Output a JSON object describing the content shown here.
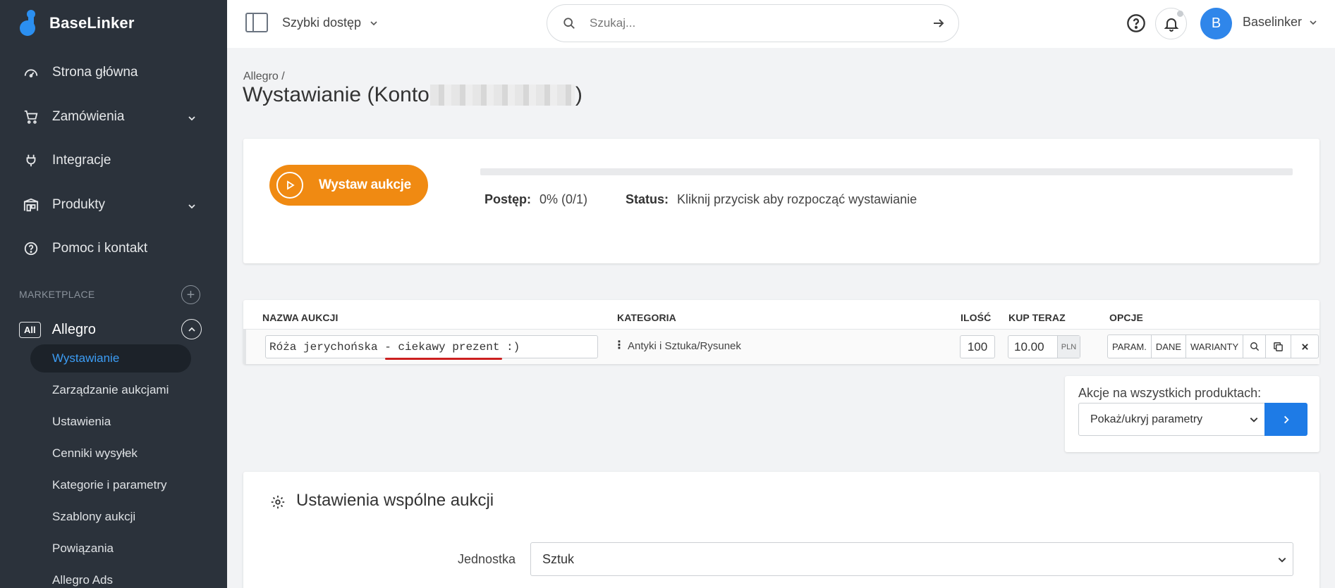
{
  "app": {
    "name": "BaseLinker"
  },
  "sidebar": {
    "nav": [
      {
        "label": "Strona główna",
        "icon": "dashboard-icon"
      },
      {
        "label": "Zamówienia",
        "icon": "cart-icon"
      },
      {
        "label": "Integracje",
        "icon": "plug-icon"
      },
      {
        "label": "Produkty",
        "icon": "warehouse-icon"
      },
      {
        "label": "Pomoc i kontakt",
        "icon": "help-icon"
      }
    ],
    "section_label": "MARKETPLACE",
    "all_badge": "All",
    "allegro_label": "Allegro",
    "sub_items": [
      {
        "label": "Wystawianie",
        "active": true
      },
      {
        "label": "Zarządzanie aukcjami"
      },
      {
        "label": "Ustawienia"
      },
      {
        "label": "Cenniki wysyłek"
      },
      {
        "label": "Kategorie i parametry"
      },
      {
        "label": "Szablony aukcji"
      },
      {
        "label": "Powiązania"
      },
      {
        "label": "Allegro Ads"
      }
    ]
  },
  "topbar": {
    "quick_access": "Szybki dostęp",
    "search_placeholder": "Szukaj...",
    "avatar_letter": "B",
    "user_name": "Baselinker"
  },
  "page": {
    "breadcrumb": "Allegro /",
    "title_prefix": "Wystawianie (Konto ",
    "title_suffix": ")"
  },
  "progress_card": {
    "button_label": "Wystaw aukcje",
    "progress_fraction": 0,
    "progress_label": "Postęp:",
    "progress_value": "0% (0/1)",
    "status_label": "Status:",
    "status_value": "Kliknij przycisk aby rozpocząć wystawianie"
  },
  "table": {
    "headers": {
      "name": "NAZWA AUKCJI",
      "category": "KATEGORIA",
      "qty": "ILOŚĆ",
      "buy_now": "KUP TERAZ",
      "options": "OPCJE"
    },
    "row": {
      "name": "Róża jerychońska - ciekawy prezent :)",
      "category": "Antyki i Sztuka/Rysunek",
      "qty": "100",
      "price": "10.00",
      "currency": "PLN",
      "btn_param": "PARAM.",
      "btn_dane": "DANE",
      "btn_warianty": "WARIANTY"
    }
  },
  "bulk_actions": {
    "label": "Akcje na wszystkich produktach:",
    "selected": "Pokaż/ukryj parametry"
  },
  "common_settings": {
    "title": "Ustawienia wspólne aukcji",
    "unit_label": "Jednostka",
    "unit_value": "Sztuk"
  },
  "colors": {
    "sidebar_bg": "#2b323b",
    "accent_orange": "#f08a12",
    "accent_blue": "#2f86ea",
    "underline_red": "#cc1f1f"
  }
}
